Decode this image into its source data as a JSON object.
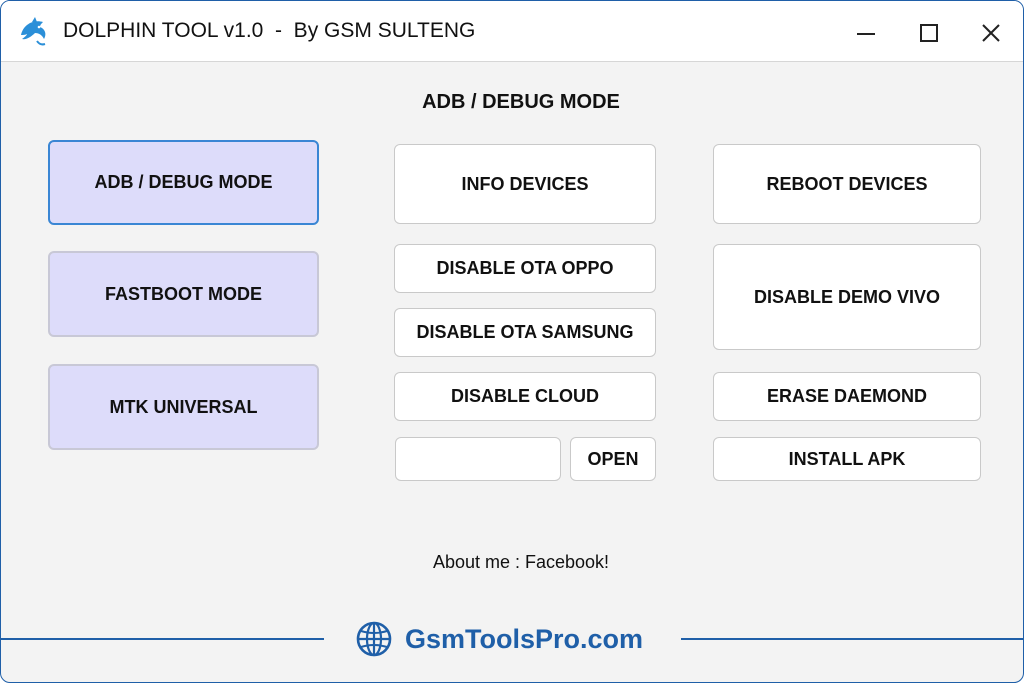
{
  "window": {
    "title": "DOLPHIN TOOL v1.0  -  By GSM SULTENG",
    "app_icon": "dolphin-icon",
    "controls": [
      "minimize-icon",
      "maximize-icon",
      "close-icon"
    ]
  },
  "section_title": "ADB / DEBUG MODE",
  "modes": [
    {
      "label": "ADB / DEBUG MODE",
      "active": true
    },
    {
      "label": "FASTBOOT MODE",
      "active": false
    },
    {
      "label": "MTK UNIVERSAL",
      "active": false
    }
  ],
  "actions": {
    "info_devices": "INFO DEVICES",
    "reboot_devices": "REBOOT DEVICES",
    "disable_ota_oppo": "DISABLE OTA OPPO",
    "disable_ota_samsung": "DISABLE OTA SAMSUNG",
    "disable_demo_vivo": "DISABLE DEMO VIVO",
    "disable_cloud": "DISABLE CLOUD",
    "erase_daemond": "ERASE DAEMOND",
    "open": "OPEN",
    "install_apk": "INSTALL APK"
  },
  "file_input": {
    "value": "",
    "placeholder": ""
  },
  "about": "About me : Facebook!",
  "footer": {
    "brand": "GsmToolsPro.com",
    "icon": "globe-icon"
  },
  "colors": {
    "accent": "#1f5fa8",
    "mode_button_bg": "#dddcfa",
    "active_border": "#3a86d4",
    "background": "#f3f3f3"
  }
}
